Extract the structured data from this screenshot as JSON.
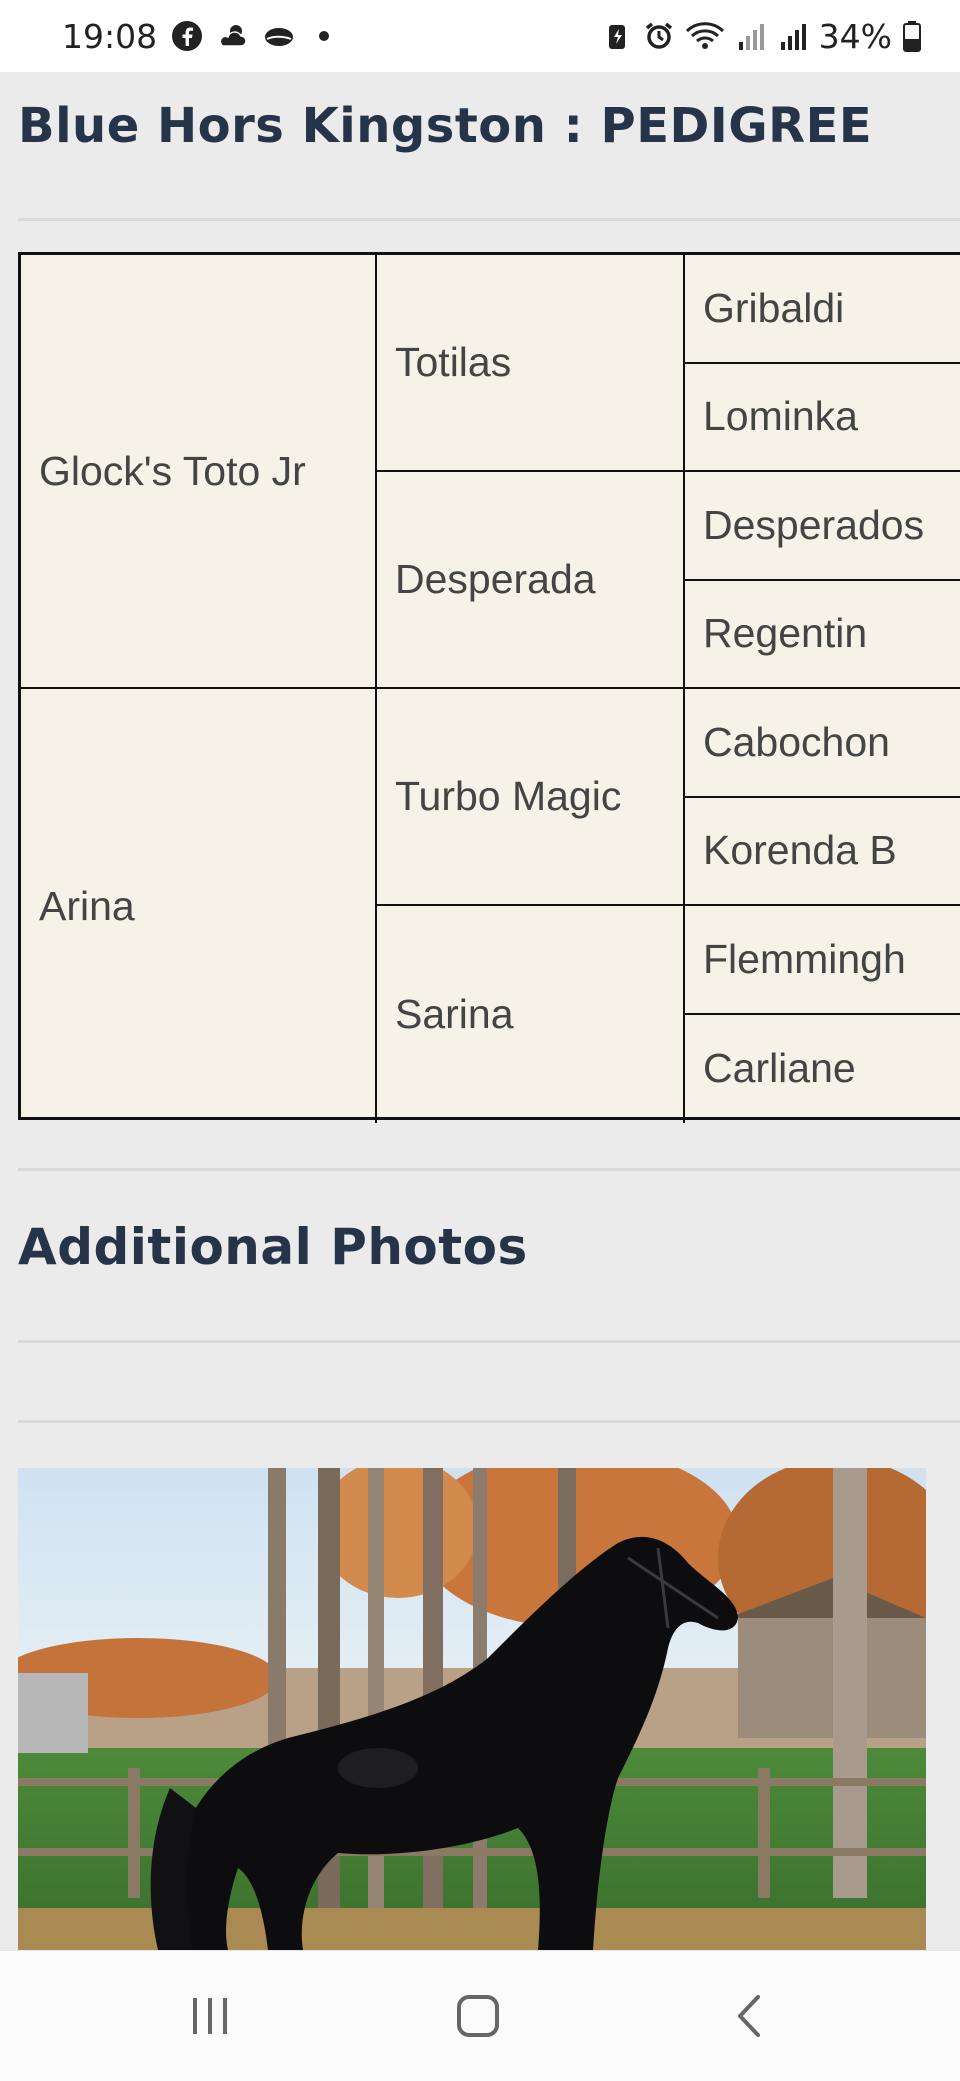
{
  "status_bar": {
    "time": "19:08",
    "battery": "34%",
    "icons": [
      "facebook-icon",
      "weather-icon",
      "cloud-icon",
      "battery-saver-icon",
      "alarm-icon",
      "wifi-icon",
      "signal-icon",
      "signal-icon",
      "battery-icon"
    ]
  },
  "page": {
    "title": "Blue Hors Kingston : PEDIGREE",
    "additional_photos_title": "Additional Photos"
  },
  "pedigree": {
    "sire": "Glock's Toto Jr",
    "dam": "Arina",
    "sire_sire": "Totilas",
    "sire_dam": "Desperada",
    "dam_sire": "Turbo Magic",
    "dam_dam": "Sarina",
    "gen3": [
      "Gribaldi",
      "Lominka",
      "Desperados",
      "Regentin",
      "Cabochon",
      "Korenda B",
      "Flemmingh",
      "Carliane"
    ]
  },
  "photo": {
    "subject": "black-horse-photo"
  },
  "nav_bar": {
    "buttons": [
      "recent-apps",
      "home",
      "back"
    ]
  },
  "colors": {
    "title": "#26344a",
    "pedigree_bg": "#f6f2e8",
    "page_bg": "#ebebeb"
  }
}
